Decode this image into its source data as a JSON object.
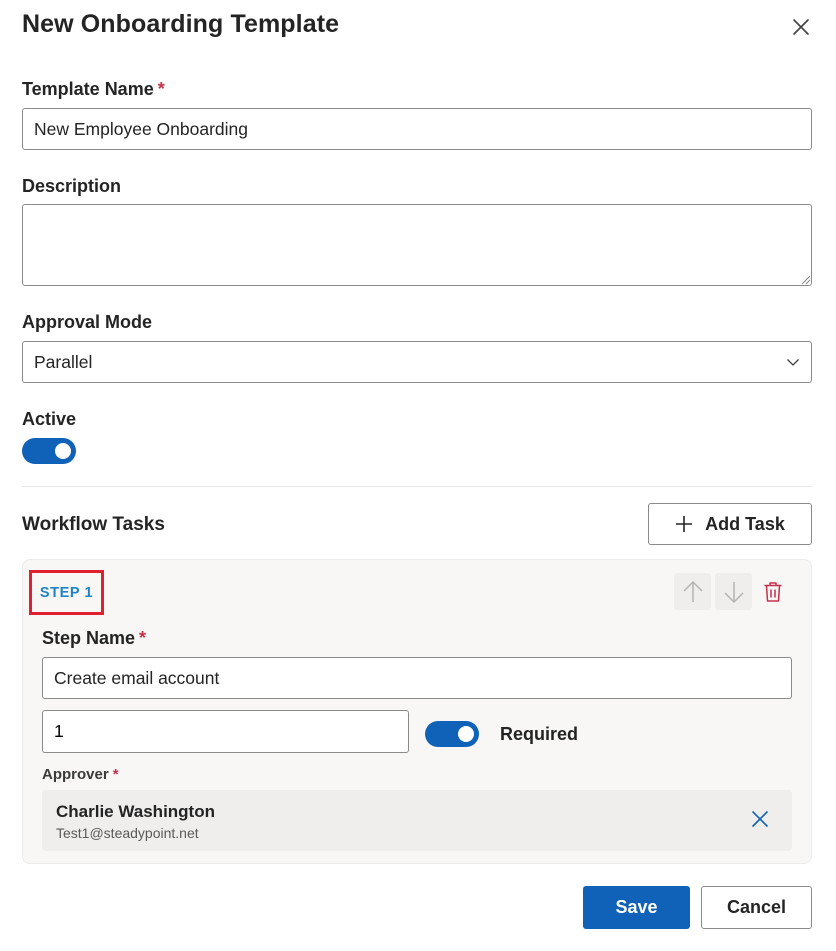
{
  "dialog": {
    "title": "New Onboarding Template"
  },
  "form": {
    "template_name_label": "Template Name",
    "template_name_value": "New Employee Onboarding",
    "description_label": "Description",
    "description_value": "",
    "approval_mode_label": "Approval Mode",
    "approval_mode_value": "Parallel",
    "active_label": "Active",
    "active_on": true,
    "required_marker": "*"
  },
  "workflow": {
    "title": "Workflow Tasks",
    "add_task_label": "Add Task",
    "steps": [
      {
        "badge": "STEP 1",
        "step_name_label": "Step Name",
        "step_name_value": "Create email account",
        "order_value": "1",
        "required_label": "Required",
        "required_on": true,
        "approver_label": "Approver",
        "approver": {
          "name": "Charlie Washington",
          "email": "Test1@steadypoint.net"
        }
      }
    ]
  },
  "footer": {
    "save_label": "Save",
    "cancel_label": "Cancel"
  },
  "icons": {
    "close": "close-icon",
    "chevron": "chevron-down-icon",
    "plus": "plus-icon",
    "up": "arrow-up-icon",
    "down": "arrow-down-icon",
    "trash": "trash-icon",
    "remove": "remove-icon"
  },
  "colors": {
    "primary": "#0f62b8",
    "step_text": "#1b85c8",
    "highlight": "#e0202e",
    "danger": "#c4314b",
    "required": "#c4314b"
  }
}
